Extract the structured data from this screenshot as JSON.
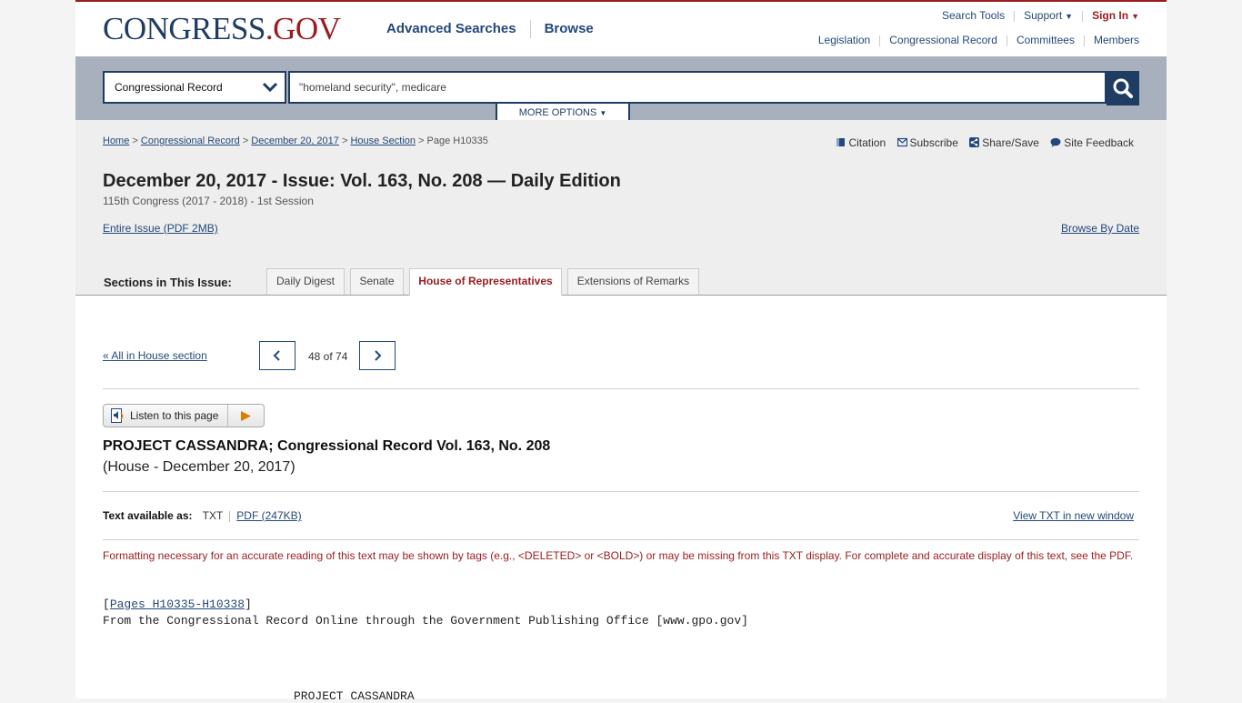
{
  "logo": {
    "part1": "CONGRESS",
    "part2": ".GOV"
  },
  "main_nav": {
    "advanced": "Advanced Searches",
    "browse": "Browse"
  },
  "utility_nav": {
    "search_tools": "Search Tools",
    "support": "Support",
    "sign_in": "Sign In"
  },
  "section_nav": {
    "legislation": "Legislation",
    "record": "Congressional Record",
    "committees": "Committees",
    "members": "Members"
  },
  "search": {
    "scope": "Congressional Record",
    "query": "\"homeland security\", medicare",
    "more_options": "MORE OPTIONS"
  },
  "breadcrumb": {
    "home": "Home",
    "record": "Congressional Record",
    "date": "December 20, 2017",
    "section": "House Section",
    "current": "Page H10335"
  },
  "tools": {
    "citation": "Citation",
    "subscribe": "Subscribe",
    "share": "Share/Save",
    "feedback": "Site Feedback"
  },
  "issue": {
    "title": "December 20, 2017 - Issue: Vol. 163, No. 208 — Daily Edition",
    "congress": "115th Congress (2017 - 2018) - 1st Session",
    "entire_issue": "Entire Issue (PDF 2MB)",
    "browse_by_date": "Browse By Date"
  },
  "sections": {
    "label": "Sections in This Issue:",
    "tabs": [
      "Daily Digest",
      "Senate",
      "House of Representatives",
      "Extensions of Remarks"
    ],
    "active": "House of Representatives"
  },
  "pager": {
    "back_link": "All in House section",
    "count": "48 of 74"
  },
  "listen": {
    "label": "Listen to this page"
  },
  "document": {
    "title": "PROJECT CASSANDRA; Congressional Record Vol. 163, No. 208",
    "subtitle": "(House - December 20, 2017)",
    "text_available_label": "Text available as:",
    "txt": "TXT",
    "pdf": "PDF (247KB)",
    "view_txt": "View TXT in new window",
    "warning": "Formatting necessary for an accurate reading of this text may be shown by tags (e.g., <DELETED> or <BOLD>) or may be missing from this TXT display. For complete and accurate display of this text, see the PDF.",
    "pages_link": "Pages H10335-H10338",
    "source_line": "From the Congressional Record Online through the Government Publishing Office [www.gpo.gov]",
    "heading": "PROJECT CASSANDRA"
  },
  "colors": {
    "brand_red": "#9a1c1f",
    "brand_navy": "#1f3c63",
    "link": "#24487a"
  }
}
